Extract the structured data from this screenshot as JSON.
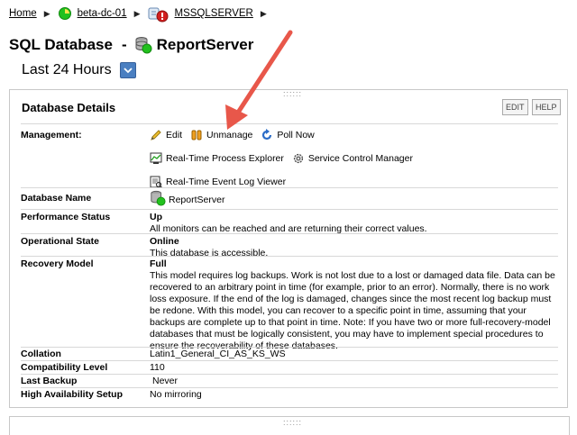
{
  "breadcrumb": {
    "home": "Home",
    "node": "beta-dc-01",
    "app": "MSSQLSERVER"
  },
  "header": {
    "type_label": "SQL Database",
    "dash": "-",
    "db_name": "ReportServer",
    "time_range": "Last 24 Hours"
  },
  "panel": {
    "title": "Database Details",
    "edit_btn": "EDIT",
    "help_btn": "HELP"
  },
  "management": {
    "label": "Management:",
    "edit": "Edit",
    "unmanage": "Unmanage",
    "poll_now": "Poll Now",
    "process_explorer": "Real-Time Process Explorer",
    "service_control": "Service Control Manager",
    "event_log": "Real-Time Event Log Viewer"
  },
  "details": {
    "db_name_label": "Database Name",
    "db_name_value": "ReportServer",
    "perf_label": "Performance Status",
    "perf_value": "Up",
    "perf_desc": "All monitors can be reached and are returning their correct values.",
    "op_label": "Operational State",
    "op_value": "Online",
    "op_desc": "This database is accessible.",
    "recovery_label": "Recovery Model",
    "recovery_value": "Full",
    "recovery_desc": "This model requires log backups. Work is not lost due to a lost or damaged data file. Data can be recovered to an arbitrary point in time (for example, prior to an error). Normally, there is no work loss exposure. If the end of the log is damaged, changes since the most recent log backup must be redone. With this model, you can recover to a specific point in time, assuming that your backups are complete up to that point in time. Note: If you have two or more full-recovery-model databases that must be logically consistent, you may have to implement special procedures to ensure the recoverability of these databases.",
    "collation_label": "Collation",
    "collation_value": "Latin1_General_CI_AS_KS_WS",
    "compat_label": "Compatibility Level",
    "compat_value": "110",
    "last_backup_label": "Last Backup",
    "last_backup_value": "Never",
    "ha_label": "High Availability Setup",
    "ha_value": "No mirroring"
  },
  "colors": {
    "status_up": "#22c11e",
    "arrow": "#e8574a",
    "accent": "#4a7fc1"
  }
}
